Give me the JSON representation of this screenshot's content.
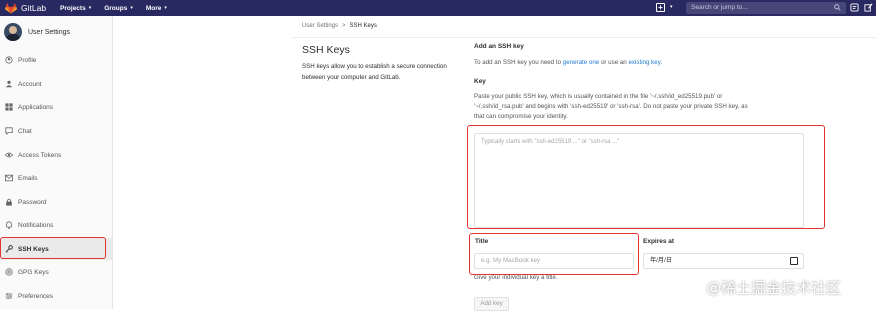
{
  "topbar": {
    "brand": "GitLab",
    "nav": [
      {
        "label": "Projects",
        "caret": "▾"
      },
      {
        "label": "Groups",
        "caret": "▾"
      },
      {
        "label": "More",
        "caret": "▾"
      }
    ],
    "new_caret": "▾",
    "search_placeholder": "Search or jump to...",
    "colors": {
      "bar": "#292961",
      "search": "#464678"
    }
  },
  "sidebar": {
    "title": "User Settings",
    "items": [
      {
        "label": "Profile",
        "icon": "profile-icon"
      },
      {
        "label": "Account",
        "icon": "account-icon"
      },
      {
        "label": "Applications",
        "icon": "applications-icon"
      },
      {
        "label": "Chat",
        "icon": "chat-icon"
      },
      {
        "label": "Access Tokens",
        "icon": "access-tokens-icon"
      },
      {
        "label": "Emails",
        "icon": "emails-icon"
      },
      {
        "label": "Password",
        "icon": "password-icon"
      },
      {
        "label": "Notifications",
        "icon": "bell-icon"
      },
      {
        "label": "SSH Keys",
        "icon": "key-icon",
        "active": true
      },
      {
        "label": "GPG Keys",
        "icon": "gpg-key-icon"
      },
      {
        "label": "Preferences",
        "icon": "preferences-icon"
      }
    ]
  },
  "breadcrumb": {
    "parent": "User Settings",
    "separator": ">",
    "current": "SSH Keys"
  },
  "page": {
    "title": "SSH Keys",
    "description": "SSH keys allow you to establish a secure connection between your computer and GitLab."
  },
  "form": {
    "section_title": "Add an SSH key",
    "intro_prefix": "To add an SSH key you need to ",
    "intro_link1": "generate one",
    "intro_middle": " or use an ",
    "intro_link2": "existing key",
    "intro_suffix": ".",
    "key_label": "Key",
    "key_help_1": "Paste your public SSH key, which is usually contained in the file '~/.ssh/id_ed25519.pub' or",
    "key_help_2": "'~/.ssh/id_rsa.pub' and begins with 'ssh-ed25519' or 'ssh-rsa'. Do not paste your private SSH key, as",
    "key_help_3": "that can compromise your identity.",
    "key_placeholder": "Typically starts with \"ssh-ed25519 ...\" or \"ssh-rsa ...\"",
    "title_label": "Title",
    "title_placeholder": "e.g. My MacBook key",
    "title_help": "Give your individual key a title.",
    "expires_label": "Expires at",
    "expires_value": "年/月/日",
    "add_button": "Add key"
  },
  "highlight_color": "#e3342f",
  "watermark": "@稀土掘金技术社区"
}
